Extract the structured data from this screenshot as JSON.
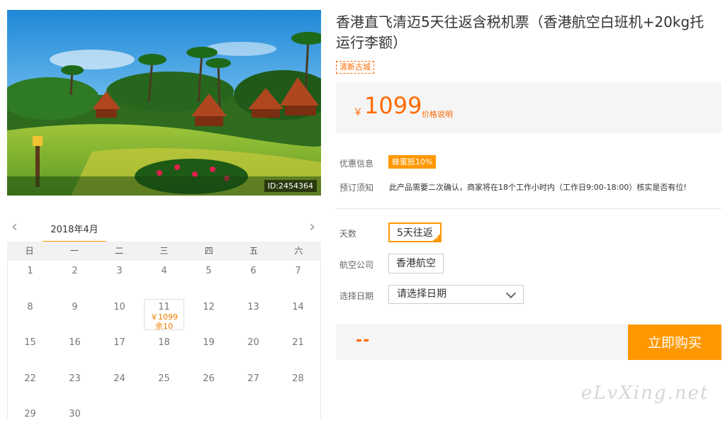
{
  "product": {
    "image_id": "ID:2454364",
    "title": "香港直飞清迈5天往返含税机票（香港航空白班机+20kg托运行李额）",
    "tag": "清新古城",
    "price": {
      "currency": "￥",
      "amount": "1099",
      "description": "价格说明"
    },
    "info": {
      "discount_label": "优惠信息",
      "discount_badge": "蜂蜜抵10%",
      "notice_label": "预订须知",
      "notice_text": "此产品需要二次确认，商家将在18个工作小时内（工作日9:00-18:00）核实是否有位!"
    },
    "options": {
      "days_label": "天数",
      "days_value": "5天往返",
      "airline_label": "航空公司",
      "airline_value": "香港航空",
      "date_label": "选择日期",
      "date_placeholder": "请选择日期"
    },
    "purchase": {
      "total": "--",
      "buy_label": "立即购买"
    }
  },
  "calendar": {
    "month": "2018年4月",
    "prev_icon": "chevron-left-icon",
    "next_icon": "chevron-right-icon",
    "weekdays": [
      "日",
      "一",
      "二",
      "三",
      "四",
      "五",
      "六"
    ],
    "days": [
      {
        "day": "1"
      },
      {
        "day": "2"
      },
      {
        "day": "3"
      },
      {
        "day": "4"
      },
      {
        "day": "5"
      },
      {
        "day": "6"
      },
      {
        "day": "7"
      },
      {
        "day": "8"
      },
      {
        "day": "9"
      },
      {
        "day": "10"
      },
      {
        "day": "11",
        "price": "￥1099",
        "remaining": "余10"
      },
      {
        "day": "12"
      },
      {
        "day": "13"
      },
      {
        "day": "14"
      },
      {
        "day": "15"
      },
      {
        "day": "16"
      },
      {
        "day": "17"
      },
      {
        "day": "18"
      },
      {
        "day": "19"
      },
      {
        "day": "20"
      },
      {
        "day": "21"
      },
      {
        "day": "22"
      },
      {
        "day": "23"
      },
      {
        "day": "24"
      },
      {
        "day": "25"
      },
      {
        "day": "26"
      },
      {
        "day": "27"
      },
      {
        "day": "28"
      },
      {
        "day": "29"
      },
      {
        "day": "30"
      }
    ]
  },
  "watermark": "eLvXing.net"
}
